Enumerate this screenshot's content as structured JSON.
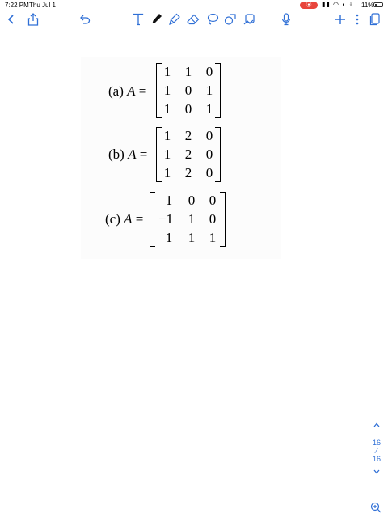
{
  "status_bar": {
    "time": "7:22 PM",
    "date": "Thu Jul 1",
    "battery": "11%"
  },
  "toolbar": {
    "back_icon": "chevron-left-icon",
    "share_icon": "share-icon",
    "undo_icon": "undo-icon",
    "text_tool_icon": "text-tool-icon",
    "pen_icon": "pen-icon",
    "highlighter_icon": "highlighter-icon",
    "eraser_icon": "eraser-icon",
    "lasso_icon": "lasso-icon",
    "shapes_icon": "shapes-icon",
    "image_icon": "image-icon",
    "mic_icon": "microphone-icon",
    "add_icon": "plus-icon",
    "more_icon": "more-icon",
    "pages_icon": "pages-icon",
    "accent": "#2f6fd6"
  },
  "equations": [
    {
      "label": "(a)",
      "variable": "A",
      "rows": [
        [
          "1",
          "1",
          "0"
        ],
        [
          "1",
          "0",
          "1"
        ],
        [
          "1",
          "0",
          "1"
        ]
      ]
    },
    {
      "label": "(b)",
      "variable": "A",
      "rows": [
        [
          "1",
          "2",
          "0"
        ],
        [
          "1",
          "2",
          "0"
        ],
        [
          "1",
          "2",
          "0"
        ]
      ]
    },
    {
      "label": "(c)",
      "variable": "A",
      "rows": [
        [
          "1",
          "0",
          "0"
        ],
        [
          "−1",
          "1",
          "0"
        ],
        [
          "1",
          "1",
          "1"
        ]
      ]
    }
  ],
  "pager": {
    "current": "16",
    "total": "16"
  }
}
